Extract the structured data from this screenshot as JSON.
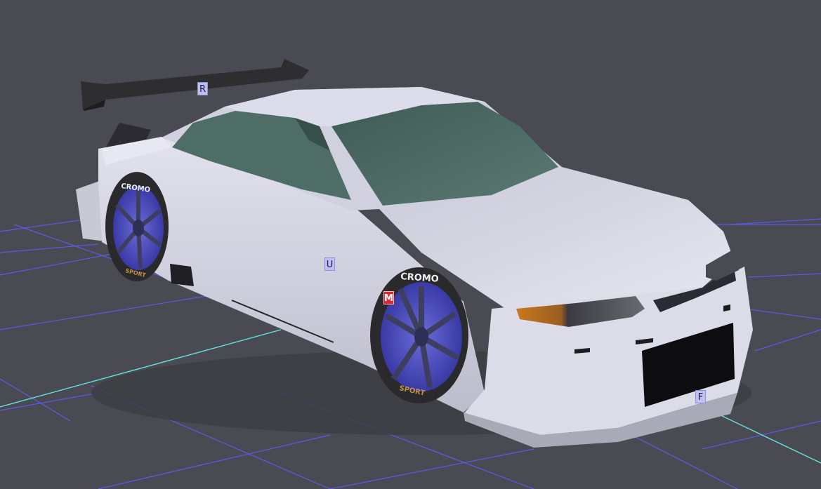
{
  "viewport": {
    "background": "#4a4a52",
    "grid_color": "#5b5be8",
    "axis_color": "#63e6dd"
  },
  "car": {
    "body_color": "#d6d6e6",
    "glass_color": "#4d6a63",
    "wheel_color": "#4a4ac0",
    "wheels": {
      "brand": "CROMO",
      "sidewall": "SPORT"
    }
  },
  "markers": [
    {
      "label": "R",
      "selected": false
    },
    {
      "label": "U",
      "selected": false
    },
    {
      "label": "M",
      "selected": true
    },
    {
      "label": "F",
      "selected": false
    }
  ]
}
